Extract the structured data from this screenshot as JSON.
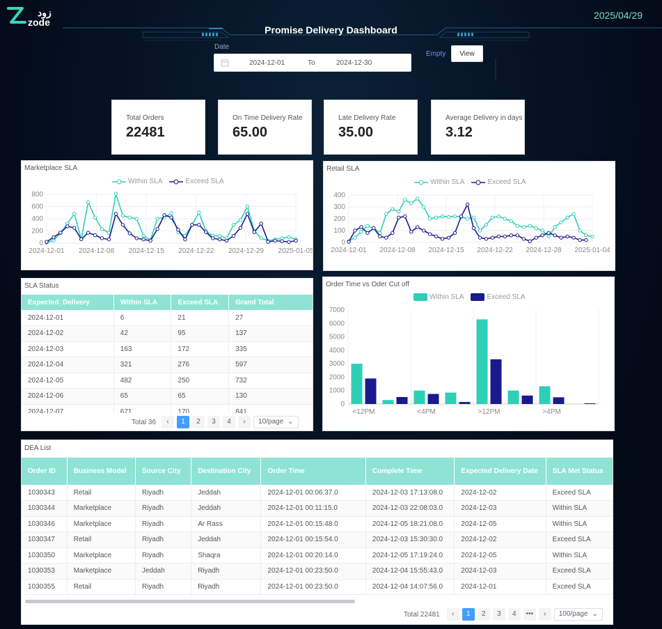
{
  "header": {
    "brand_arabic": "زود",
    "brand_latin": "zode",
    "title": "Promise Delivery Dashboard",
    "date": "2025/04/29"
  },
  "filter": {
    "label": "Date",
    "start": "2024-12-01",
    "separator": "To",
    "end": "2024-12-30",
    "empty_label": "Empty",
    "view_label": "View"
  },
  "kpis": [
    {
      "label": "Total Orders",
      "value": "22481"
    },
    {
      "label": "On Time Delivery Rate",
      "value": "65.00"
    },
    {
      "label": "Late Delivery Rate",
      "value": "35.00"
    },
    {
      "label": "Average Delivery in days",
      "value": "3.12"
    }
  ],
  "colors": {
    "within": "#2ecfb6",
    "exceed": "#1a1a8c",
    "header_bg": "#8ee3d4",
    "accent": "#409eff"
  },
  "chart_data": [
    {
      "type": "line",
      "title": "Marketplace SLA",
      "series": [
        {
          "name": "Within SLA",
          "values": [
            6,
            42,
            163,
            321,
            482,
            65,
            671,
            420,
            230,
            170,
            810,
            450,
            420,
            400,
            120,
            50,
            400,
            420,
            490,
            180,
            120,
            300,
            500,
            200,
            120,
            120,
            80,
            300,
            380,
            600,
            200,
            80,
            40,
            60,
            80,
            100,
            60
          ]
        },
        {
          "name": "Exceed SLA",
          "values": [
            21,
            95,
            172,
            276,
            250,
            65,
            170,
            130,
            80,
            60,
            480,
            300,
            160,
            80,
            60,
            40,
            230,
            460,
            420,
            220,
            60,
            300,
            300,
            180,
            80,
            60,
            40,
            120,
            250,
            480,
            180,
            320,
            20,
            40,
            30,
            20,
            40
          ]
        }
      ],
      "x_ticks": [
        "2024-12-01",
        "2024-12-08",
        "2024-12-15",
        "2024-12-22",
        "2024-12-29",
        "2025-01-05"
      ],
      "y_ticks": [
        0,
        200,
        400,
        600,
        800
      ],
      "ylim": [
        0,
        800
      ]
    },
    {
      "type": "line",
      "title": "Retail SLA",
      "series": [
        {
          "name": "Within SLA",
          "values": [
            10,
            40,
            90,
            140,
            120,
            80,
            240,
            280,
            260,
            360,
            330,
            370,
            300,
            200,
            210,
            220,
            215,
            220,
            215,
            200,
            210,
            100,
            150,
            210,
            220,
            200,
            180,
            140,
            130,
            140,
            120,
            100,
            50,
            130,
            170,
            210,
            240,
            100,
            60,
            50
          ]
        },
        {
          "name": "Exceed SLA",
          "values": [
            5,
            100,
            130,
            80,
            120,
            50,
            40,
            80,
            210,
            220,
            90,
            130,
            100,
            70,
            50,
            30,
            40,
            80,
            220,
            320,
            120,
            40,
            30,
            40,
            50,
            50,
            60,
            60,
            30,
            10,
            40,
            60,
            80,
            60,
            40,
            50,
            40,
            20,
            20
          ]
        }
      ],
      "x_ticks": [
        "2024-12-01",
        "2024-12-08",
        "2024-12-15",
        "2024-12-22",
        "2024-12-28",
        "2025-01-04"
      ],
      "y_ticks": [
        0,
        100,
        200,
        300,
        400
      ],
      "ylim": [
        0,
        400
      ]
    },
    {
      "type": "bar",
      "title": "Order Time vs Oder Cut off",
      "categories": [
        "<12PM",
        "",
        "<4PM",
        "",
        ">12PM",
        "",
        ">4PM",
        ""
      ],
      "series": [
        {
          "name": "Within SLA",
          "values": [
            3000,
            300,
            1000,
            850,
            6300,
            1000,
            1320,
            0
          ]
        },
        {
          "name": "Exceed SLA",
          "values": [
            1900,
            520,
            750,
            150,
            3330,
            630,
            500,
            50
          ]
        }
      ],
      "y_ticks": [
        0,
        1000,
        2000,
        3000,
        4000,
        5000,
        6000,
        7000
      ],
      "ylim": [
        0,
        7000
      ]
    }
  ],
  "sla_status": {
    "title": "SLA Status",
    "columns": [
      "Expected_Delivery",
      "Within SLA",
      "Exceed SLA",
      "Grand Total"
    ],
    "rows": [
      [
        "2024-12-01",
        "6",
        "21",
        "27"
      ],
      [
        "2024-12-02",
        "42",
        "95",
        "137"
      ],
      [
        "2024-12-03",
        "163",
        "172",
        "335"
      ],
      [
        "2024-12-04",
        "321",
        "276",
        "597"
      ],
      [
        "2024-12-05",
        "482",
        "250",
        "732"
      ],
      [
        "2024-12-06",
        "65",
        "65",
        "130"
      ],
      [
        "2024-12-07",
        "671",
        "170",
        "841"
      ]
    ],
    "pager": {
      "total": "Total 36",
      "pages": [
        "1",
        "2",
        "3",
        "4"
      ],
      "page_size": "10/page"
    }
  },
  "dea_list": {
    "title": "DEA List",
    "columns": [
      "Order ID",
      "Business Model",
      "Source City",
      "Destination City",
      "Order Time",
      "Complete Time",
      "Expected Delivery Date",
      "SLA Met Status"
    ],
    "rows": [
      [
        "1030343",
        "Retail",
        "Riyadh",
        "Jeddah",
        "2024-12-01 00:06:37.0",
        "2024-12-03 17:13:08.0",
        "2024-12-02",
        "Exceed SLA"
      ],
      [
        "1030344",
        "Marketplace",
        "Riyadh",
        "Jeddah",
        "2024-12-01 00:11:15.0",
        "2024-12-03 22:08:03.0",
        "2024-12-03",
        "Within SLA"
      ],
      [
        "1030346",
        "Marketplace",
        "Riyadh",
        "Ar Rass",
        "2024-12-01 00:15:48.0",
        "2024-12-05 18:21:08.0",
        "2024-12-05",
        "Within SLA"
      ],
      [
        "1030347",
        "Retail",
        "Riyadh",
        "Jeddah",
        "2024-12-01 00:15:54.0",
        "2024-12-03 15:30:30.0",
        "2024-12-02",
        "Exceed SLA"
      ],
      [
        "1030350",
        "Marketplace",
        "Riyadh",
        "Shaqra",
        "2024-12-01 00:20:14.0",
        "2024-12-05 17:19:24.0",
        "2024-12-05",
        "Within SLA"
      ],
      [
        "1030353",
        "Marketplace",
        "Jeddah",
        "Riyadh",
        "2024-12-01 00:23:50.0",
        "2024-12-04 15:55:43.0",
        "2024-12-03",
        "Exceed SLA"
      ],
      [
        "1030355",
        "Retail",
        "Riyadh",
        "Riyadh",
        "2024-12-01 00:23:50.0",
        "2024-12-04 14:07:56.0",
        "2024-12-01",
        "Exceed SLA"
      ]
    ],
    "pager": {
      "total": "Total 22481",
      "pages": [
        "1",
        "2",
        "3",
        "4"
      ],
      "more": "•••",
      "page_size": "100/page"
    }
  }
}
